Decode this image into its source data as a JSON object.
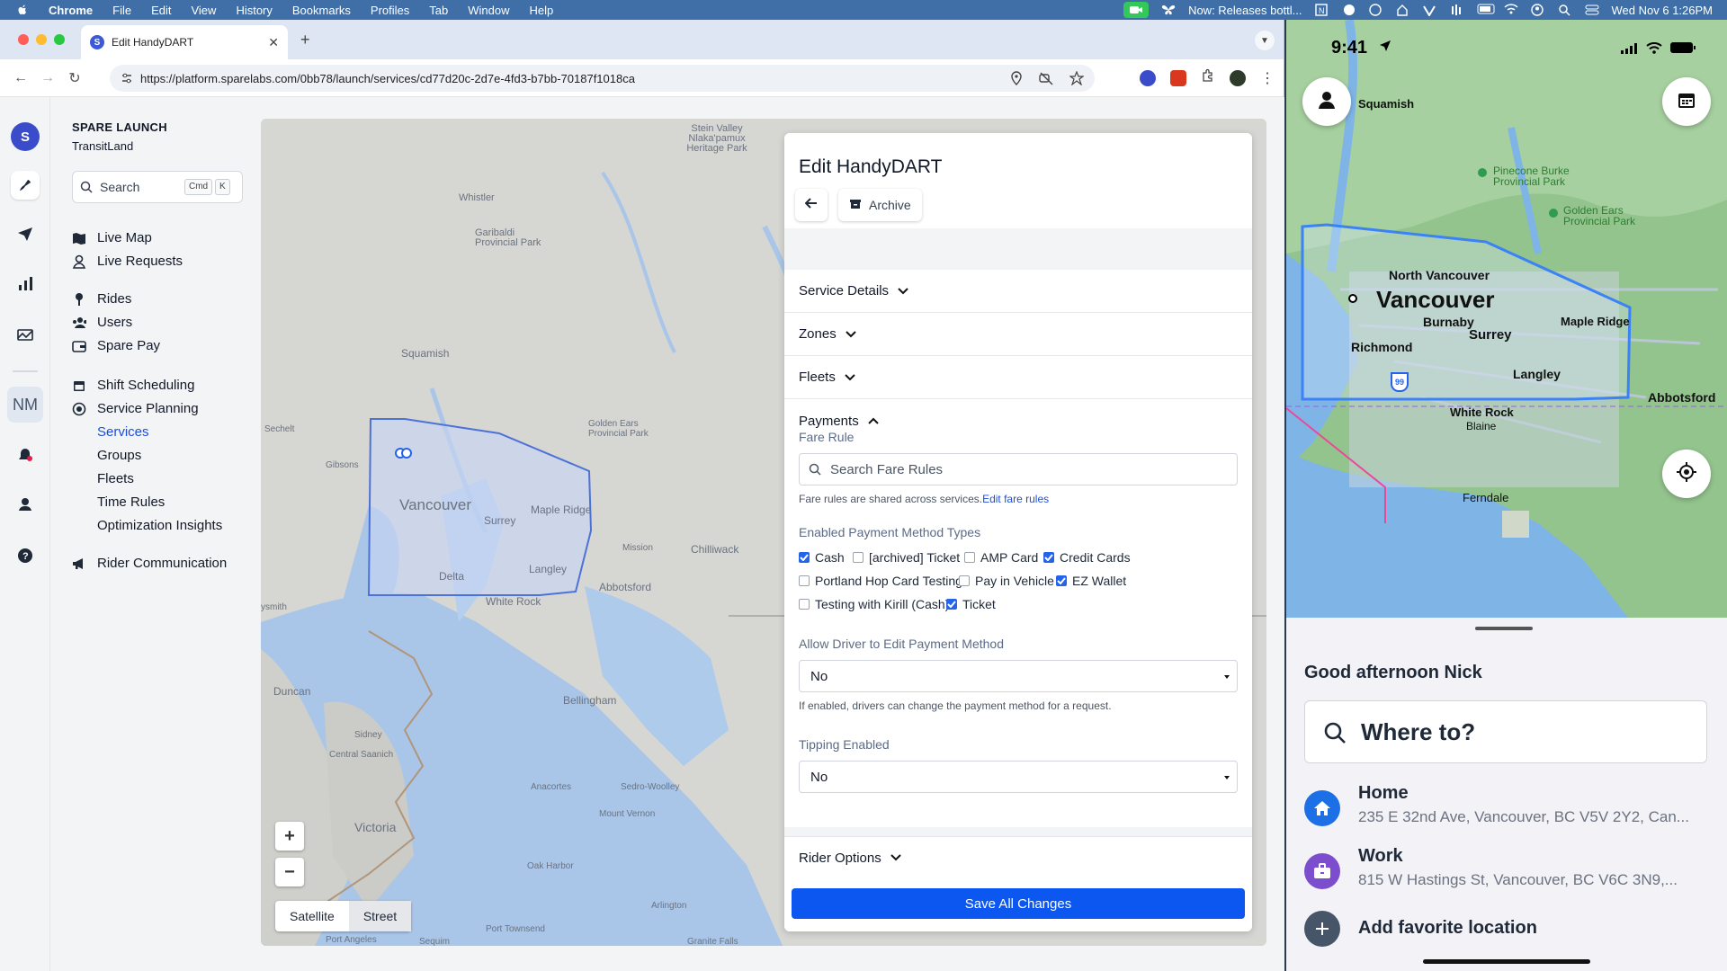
{
  "menubar": {
    "app": "Chrome",
    "items": [
      "File",
      "Edit",
      "View",
      "History",
      "Bookmarks",
      "Profiles",
      "Tab",
      "Window",
      "Help"
    ],
    "now_playing": "Now: Releases bottl...",
    "datetime": "Wed Nov 6  1:26PM"
  },
  "browser": {
    "tab_title": "Edit HandyDART",
    "tab_favicon": "S",
    "url": "https://platform.sparelabs.com/0bb78/launch/services/cd77d20c-2d7e-4fd3-b7bb-70187f1018ca"
  },
  "rail": {
    "logo": "S",
    "initials": "NM"
  },
  "sidebar": {
    "org_name": "SPARE LAUNCH",
    "org_sub": "TransitLand",
    "search_placeholder": "Search",
    "search_kbd1": "Cmd",
    "search_kbd2": "K",
    "items": {
      "live_map": "Live Map",
      "live_requests": "Live Requests",
      "rides": "Rides",
      "users": "Users",
      "spare_pay": "Spare Pay",
      "shift_scheduling": "Shift Scheduling",
      "service_planning": "Service Planning",
      "services": "Services",
      "groups": "Groups",
      "fleets": "Fleets",
      "time_rules": "Time Rules",
      "optimization_insights": "Optimization Insights",
      "rider_communication": "Rider Communication"
    }
  },
  "map": {
    "labels": {
      "stein": "Stein Valley Nlaka'pamux Heritage Park",
      "whistler": "Whistler",
      "garibaldi": "Garibaldi Provincial Park",
      "squamish": "Squamish",
      "sechelt": "Sechelt",
      "gibsons": "Gibsons",
      "golden_ears": "Golden Ears Provincial Park",
      "vancouver": "Vancouver",
      "surrey": "Surrey",
      "maple_ridge": "Maple Ridge",
      "mission": "Mission",
      "chilliwack": "Chilliwack",
      "delta": "Delta",
      "langley": "Langley",
      "abbotsford": "Abbotsford",
      "white_rock": "White Rock",
      "nanaimo": "ysmith",
      "duncan": "Duncan",
      "bellingham": "Bellingham",
      "sidney": "Sidney",
      "central_saanich": "Central Saanich",
      "victoria": "Victoria",
      "anacortes": "Anacortes",
      "sedro_woolley": "Sedro-Woolley",
      "mount_vernon": "Mount Vernon",
      "oak_harbor": "Oak Harbor",
      "arlington": "Arlington",
      "port_townsend": "Port Townsend",
      "port_angeles": "Port Angeles",
      "sequim": "Sequim",
      "granite_falls": "Granite Falls"
    },
    "zoom_in": "+",
    "zoom_out": "−",
    "satellite": "Satellite",
    "street": "Street"
  },
  "panel": {
    "title": "Edit HandyDART",
    "archive": "Archive",
    "sections": {
      "service_details": "Service Details",
      "zones": "Zones",
      "fleets": "Fleets",
      "payments": "Payments",
      "rider_options": "Rider Options"
    },
    "fare_rule_label": "Fare Rule",
    "fare_search_placeholder": "Search Fare Rules",
    "fare_hint": "Fare rules are shared across services.",
    "fare_hint_link": "Edit fare rules",
    "payment_types_label": "Enabled Payment Method Types",
    "payment_types": [
      {
        "label": "Cash",
        "checked": true
      },
      {
        "label": "[archived] Ticket",
        "checked": false
      },
      {
        "label": "AMP Card",
        "checked": false
      },
      {
        "label": "Credit Cards",
        "checked": true
      },
      {
        "label": "Portland Hop Card Testing",
        "checked": false
      },
      {
        "label": "Pay in Vehicle",
        "checked": false
      },
      {
        "label": "EZ Wallet",
        "checked": true
      },
      {
        "label": "Testing with Kirill (Cash)",
        "checked": false
      },
      {
        "label": "Ticket",
        "checked": true
      }
    ],
    "allow_driver_label": "Allow Driver to Edit Payment Method",
    "allow_driver_value": "No",
    "allow_driver_hint": "If enabled, drivers can change the payment method for a request.",
    "tipping_label": "Tipping Enabled",
    "tipping_value": "No",
    "save": "Save All Changes"
  },
  "phone": {
    "time": "9:41",
    "map_labels": {
      "squamish": "Squamish",
      "pinecone": "Pinecone Burke Provincial Park",
      "golden_ears": "Golden Ears Provincial Park",
      "north_vancouver": "North Vancouver",
      "vancouver": "Vancouver",
      "burnaby": "Burnaby",
      "maple_ridge": "Maple Ridge",
      "surrey": "Surrey",
      "richmond": "Richmond",
      "langley": "Langley",
      "abbotsford": "Abbotsford",
      "white_rock": "White Rock",
      "blaine": "Blaine",
      "ferndale": "Ferndale",
      "highway": "99"
    },
    "greeting": "Good afternoon Nick",
    "where_to": "Where to?",
    "home_title": "Home",
    "home_address": "235 E 32nd Ave, Vancouver, BC V5V 2Y2, Can...",
    "work_title": "Work",
    "work_address": "815 W Hastings St, Vancouver, BC V6C 3N9,...",
    "add_favorite": "Add favorite location"
  },
  "colors": {
    "primary": "#0b57f0",
    "link": "#1d4ed8",
    "zone_fill": "#c7d4f2",
    "zone_stroke": "#4c72d8",
    "menubar": "#3f6fa6"
  }
}
